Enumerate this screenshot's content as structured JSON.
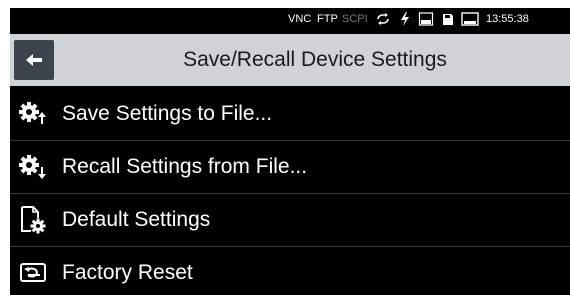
{
  "status_bar": {
    "vnc": "VNC",
    "ftp": "FTP",
    "scpi": "SCPI",
    "time": "13:55:38",
    "icons": [
      "loop-icon",
      "flash-icon",
      "log-icon",
      "disk-icon",
      "screen-icon"
    ]
  },
  "title_bar": {
    "back_icon": "back-arrow-icon",
    "title": "Save/Recall Device Settings"
  },
  "menu": {
    "items": [
      {
        "label": "Save Settings to File...",
        "icon": "gear-upload-icon"
      },
      {
        "label": "Recall Settings from File...",
        "icon": "gear-download-icon"
      },
      {
        "label": "Default Settings",
        "icon": "document-gear-icon"
      },
      {
        "label": "Factory Reset",
        "icon": "factory-reset-icon"
      }
    ]
  },
  "colors": {
    "background": "#000000",
    "title_bar": "#cfd2d6",
    "back_button": "#3c444d",
    "divider": "#3a3a3a",
    "text": "#ffffff",
    "muted": "#7a7a7a"
  }
}
